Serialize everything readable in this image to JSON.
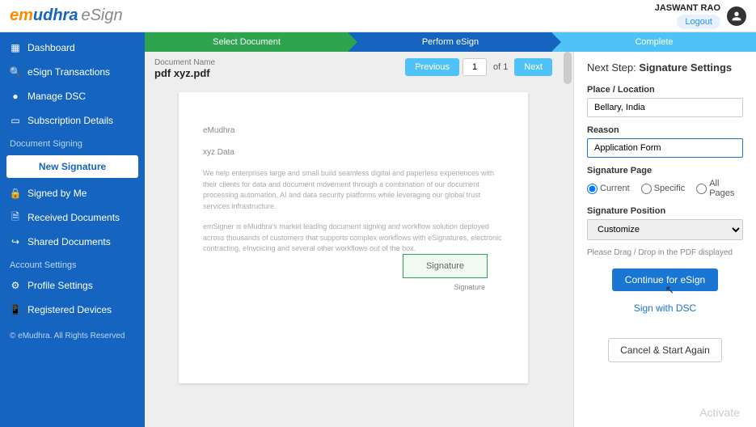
{
  "brand": {
    "part1": "em",
    "part2": "udhra",
    "part3": "eSign"
  },
  "user": {
    "name": "JASWANT RAO",
    "logout_label": "Logout"
  },
  "sidebar": {
    "main_items": [
      {
        "label": "Dashboard",
        "icon": "dashboard-icon"
      },
      {
        "label": "eSign Transactions",
        "icon": "search-icon"
      },
      {
        "label": "Manage DSC",
        "icon": "circle-icon"
      },
      {
        "label": "Subscription Details",
        "icon": "card-icon"
      }
    ],
    "section1": "Document Signing",
    "new_signature": "New Signature",
    "doc_items": [
      {
        "label": "Signed by Me",
        "icon": "lock-icon"
      },
      {
        "label": "Received Documents",
        "icon": "file-icon"
      },
      {
        "label": "Shared Documents",
        "icon": "share-icon"
      }
    ],
    "section2": "Account Settings",
    "acct_items": [
      {
        "label": "Profile Settings",
        "icon": "gear-icon"
      },
      {
        "label": "Registered Devices",
        "icon": "device-icon"
      }
    ],
    "copyright": "© eMudhra. All Rights Reserved"
  },
  "steps": {
    "s1": "Select Document",
    "s2": "Perform eSign",
    "s3": "Complete"
  },
  "doc": {
    "name_label": "Document Name",
    "name": "pdf xyz.pdf",
    "nav": {
      "prev": "Previous",
      "page": "1",
      "of": "of 1",
      "next": "Next"
    },
    "page": {
      "h1": "eMudhra",
      "h2": "xyz Data",
      "p1": "We help enterprises large and small build seamless digital and paperless experiences with their clients for data and document movement through a combination of our document processing automation, AI and data security platforms while leveraging our global trust services infrastructure.",
      "p2": "emSigner is eMudhra's market leading document signing and workflow solution deployed across thousands of customers that supports complex workflows with eSignatures, electronic contracting, eInvoicing and several other workflows out of the box.",
      "signature_box": "Signature",
      "signature_label": "Signature"
    }
  },
  "right": {
    "title_prefix": "Next Step: ",
    "title_bold": "Signature Settings",
    "place_label": "Place / Location",
    "place_value": "Bellary, India",
    "reason_label": "Reason",
    "reason_value": "Application Form",
    "sigpage_label": "Signature Page",
    "radios": {
      "current": "Current",
      "specific": "Specific",
      "all": "All Pages"
    },
    "sigpos_label": "Signature Position",
    "sigpos_value": "Customize",
    "hint": "Please Drag / Drop in the PDF displayed",
    "continue": "Continue for eSign",
    "dsc": "Sign with DSC",
    "cancel": "Cancel & Start Again"
  },
  "watermark": "Activate"
}
